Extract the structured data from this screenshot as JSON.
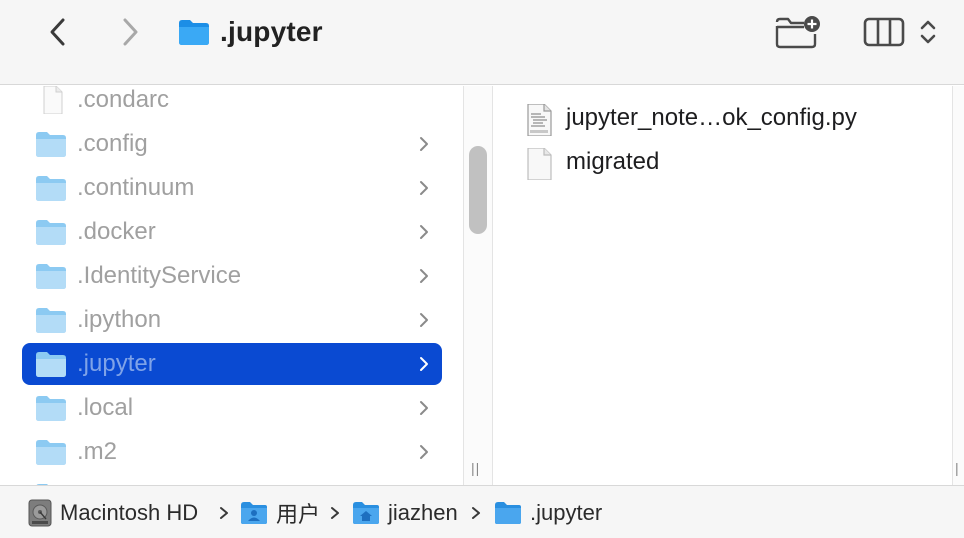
{
  "toolbar": {
    "title": ".jupyter",
    "back_icon": "chevron-left-icon",
    "forward_icon": "chevron-right-icon",
    "new_folder_icon": "new-folder-icon",
    "view_icon": "column-view-icon",
    "view_toggle_icon": "updown-chevron-icon"
  },
  "sidebar_column": {
    "items": [
      {
        "label": ".condarc",
        "type": "file",
        "has_chevron": false
      },
      {
        "label": ".config",
        "type": "folder",
        "has_chevron": true
      },
      {
        "label": ".continuum",
        "type": "folder",
        "has_chevron": true
      },
      {
        "label": ".docker",
        "type": "folder",
        "has_chevron": true
      },
      {
        "label": ".IdentityService",
        "type": "folder",
        "has_chevron": true
      },
      {
        "label": ".ipython",
        "type": "folder",
        "has_chevron": true
      },
      {
        "label": ".jupyter",
        "type": "folder",
        "has_chevron": true,
        "selected": true
      },
      {
        "label": ".local",
        "type": "folder",
        "has_chevron": true
      },
      {
        "label": ".m2",
        "type": "folder",
        "has_chevron": true
      }
    ]
  },
  "content_column": {
    "items": [
      {
        "label": "jupyter_note…ok_config.py",
        "type": "python-file"
      },
      {
        "label": "migrated",
        "type": "file"
      }
    ]
  },
  "pathbar": {
    "crumbs": [
      {
        "label": "Macintosh HD",
        "icon": "hard-drive-icon"
      },
      {
        "label": "用户",
        "icon": "users-folder-icon"
      },
      {
        "label": "jiazhen",
        "icon": "home-folder-icon"
      },
      {
        "label": ".jupyter",
        "icon": "folder-icon"
      }
    ]
  },
  "colors": {
    "selection": "#0a4ad2",
    "folder": "#7cc3f0",
    "toolbar_bg": "#f6f6f6"
  }
}
